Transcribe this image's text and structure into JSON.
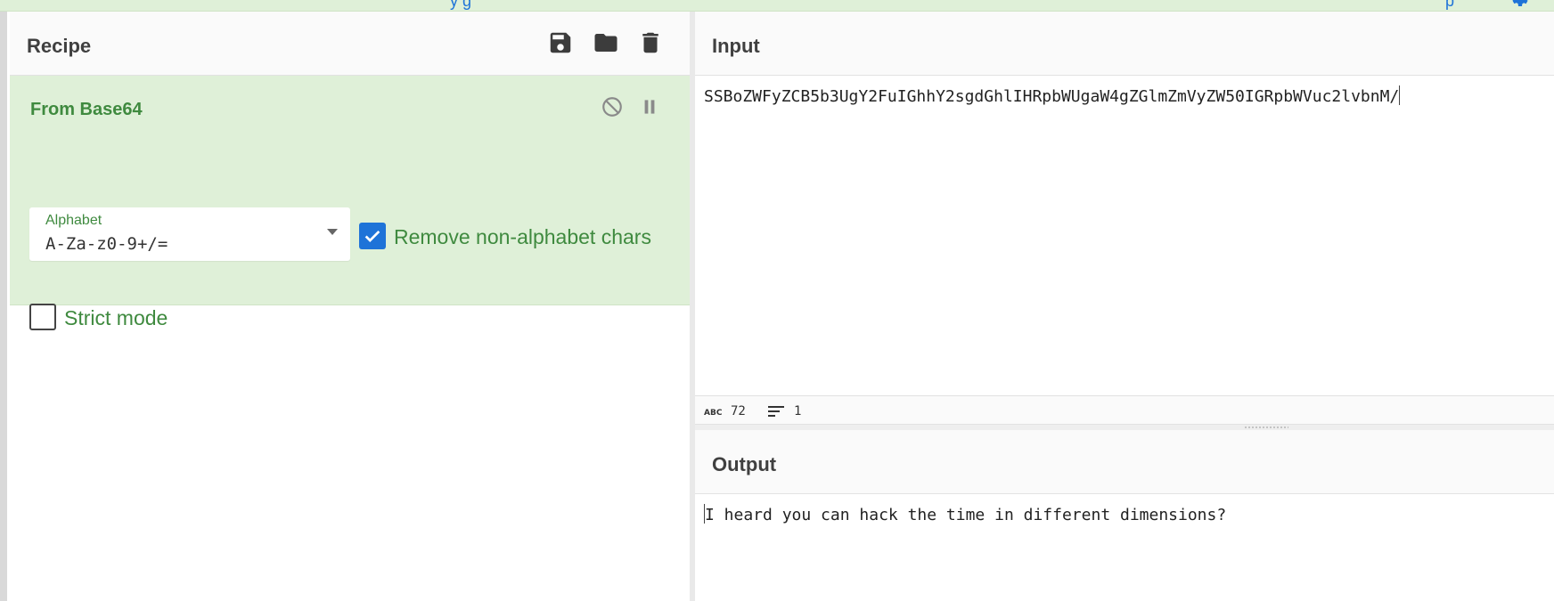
{
  "recipe": {
    "title": "Recipe",
    "buttons": [
      "save-icon",
      "folder-icon",
      "trash-icon"
    ],
    "operation": {
      "name": "From Base64",
      "alphabet_label": "Alphabet",
      "alphabet_value": "A-Za-z0-9+/=",
      "remove_non_alphabet": {
        "label": "Remove non-alphabet chars",
        "checked": true
      },
      "strict_mode": {
        "label": "Strict mode",
        "checked": false
      }
    }
  },
  "input": {
    "title": "Input",
    "text": "SSBoZWFyZCB5b3UgY2FuIGhhY2sgdGhlIHRpbWUgaW4gZGlmZmVyZW50IGRpbWVuc2lvbnM/",
    "stats": {
      "length": "72",
      "lines": "1"
    }
  },
  "output": {
    "title": "Output",
    "text": "I heard you can hack the time in different dimensions?"
  },
  "colors": {
    "operation_bg": "#dff0d8",
    "operation_text": "#3f8a3f",
    "checkbox_checked": "#1e73d8"
  }
}
